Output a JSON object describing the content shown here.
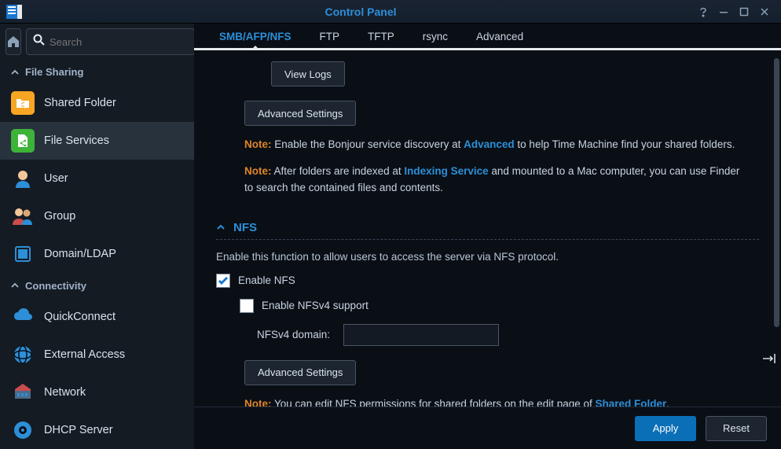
{
  "window": {
    "title": "Control Panel"
  },
  "search": {
    "placeholder": "Search"
  },
  "sidebar": {
    "sections": [
      {
        "header": "File Sharing",
        "items": [
          {
            "label": "Shared Folder"
          },
          {
            "label": "File Services"
          },
          {
            "label": "User"
          },
          {
            "label": "Group"
          },
          {
            "label": "Domain/LDAP"
          }
        ]
      },
      {
        "header": "Connectivity",
        "items": [
          {
            "label": "QuickConnect"
          },
          {
            "label": "External Access"
          },
          {
            "label": "Network"
          },
          {
            "label": "DHCP Server"
          }
        ]
      }
    ]
  },
  "tabs": [
    {
      "label": "SMB/AFP/NFS"
    },
    {
      "label": "FTP"
    },
    {
      "label": "TFTP"
    },
    {
      "label": "rsync"
    },
    {
      "label": "Advanced"
    }
  ],
  "buttons": {
    "view_logs": "View Logs",
    "adv_settings_1": "Advanced Settings",
    "adv_settings_2": "Advanced Settings",
    "apply": "Apply",
    "reset": "Reset"
  },
  "notes": {
    "label": "Note:",
    "n1_pre": " Enable the Bonjour service discovery at ",
    "n1_link": "Advanced",
    "n1_post": " to help Time Machine find your shared folders.",
    "n2_pre": " After folders are indexed at ",
    "n2_link": "Indexing Service",
    "n2_post": " and mounted to a Mac computer, you can use Finder to search the contained files and contents.",
    "n3_pre": " You can edit NFS permissions for shared folders on the edit page of ",
    "n3_link": "Shared Folder",
    "n3_post": "."
  },
  "nfs": {
    "title": "NFS",
    "desc": "Enable this function to allow users to access the server via NFS protocol.",
    "enable_label": "Enable NFS",
    "v4_label": "Enable NFSv4 support",
    "domain_label": "NFSv4 domain:",
    "domain_value": ""
  }
}
